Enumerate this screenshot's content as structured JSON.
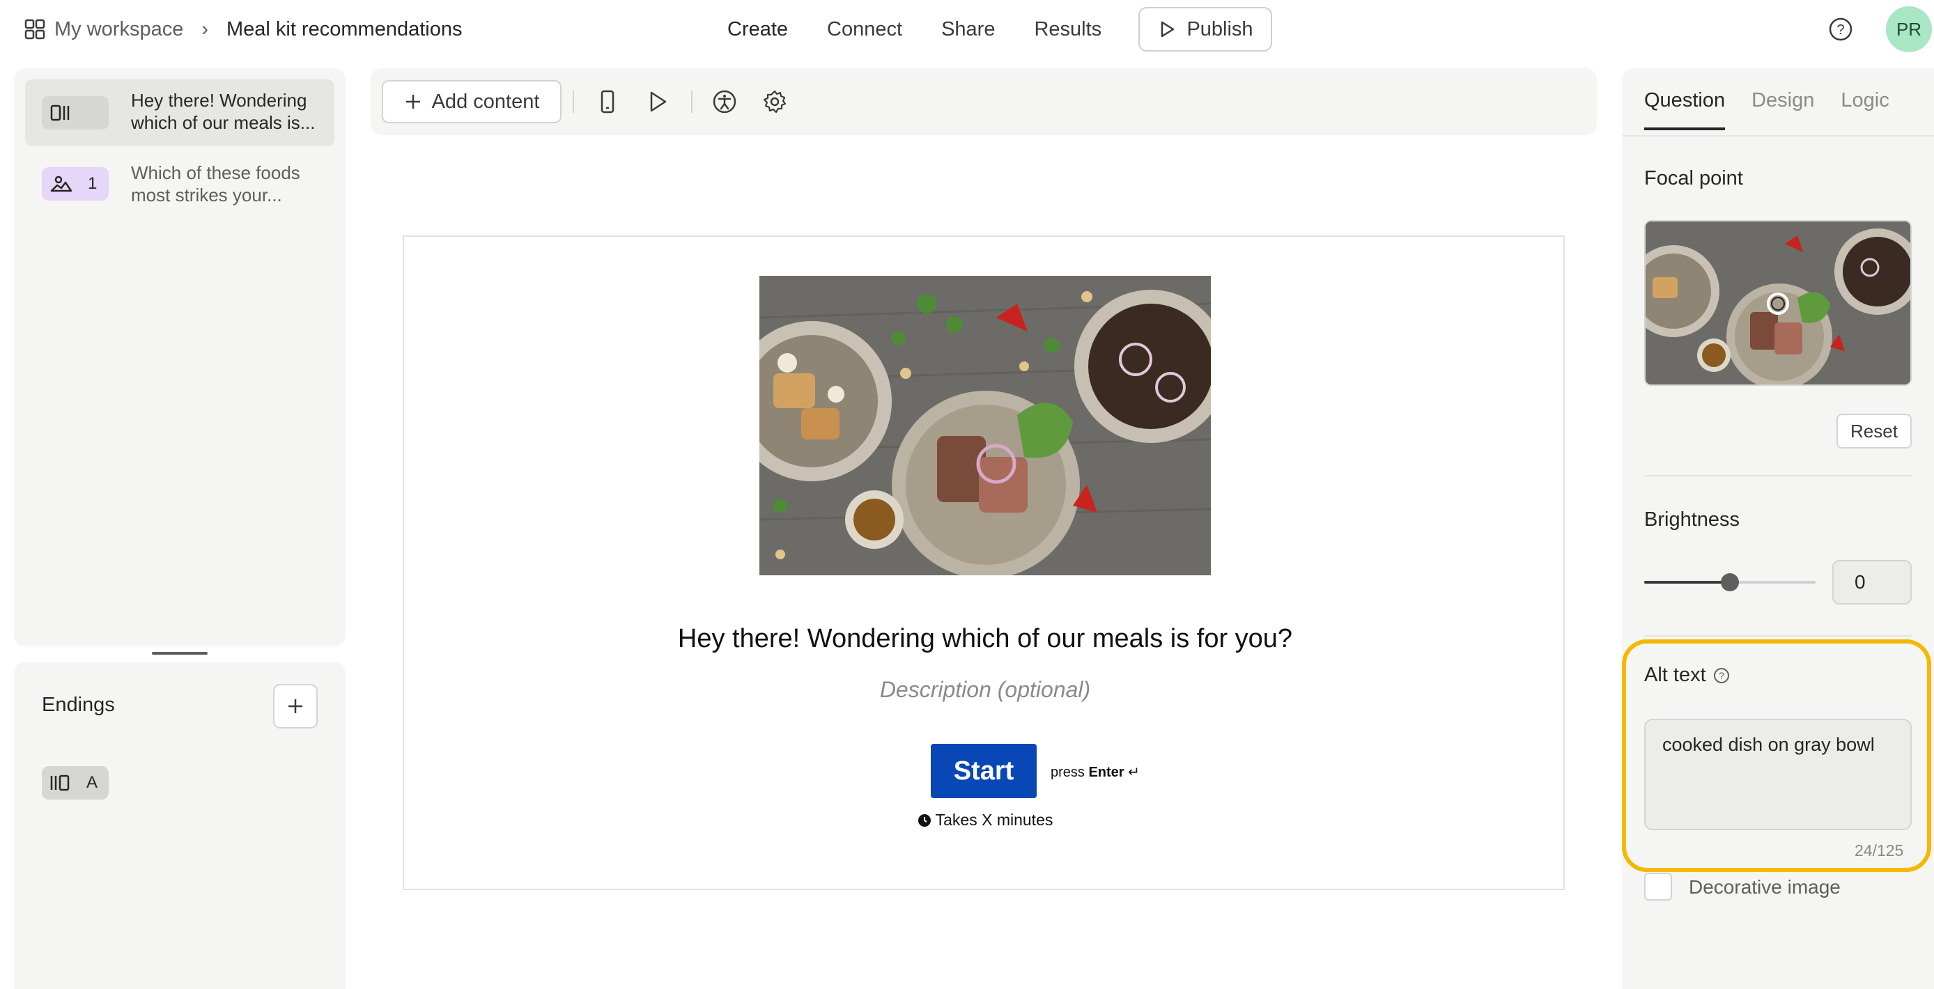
{
  "header": {
    "workspace": "My workspace",
    "form_name": "Meal kit recommendations",
    "nav": [
      "Create",
      "Connect",
      "Share",
      "Results"
    ],
    "publish_label": "Publish",
    "avatar_initials": "PR"
  },
  "questions": [
    {
      "text": "Hey there! Wondering which of our meals is...",
      "badge_number": ""
    },
    {
      "text": "Which of these foods most strikes your...",
      "badge_number": "1"
    }
  ],
  "endings": {
    "title": "Endings",
    "items": [
      {
        "letter": "A"
      }
    ]
  },
  "toolbar": {
    "add_content_label": "Add content"
  },
  "welcome": {
    "title": "Hey there! Wondering which of our meals is for you?",
    "description_placeholder": "Description (optional)",
    "start_label": "Start",
    "press_prefix": "press",
    "press_key": "Enter",
    "press_symbol": "↵",
    "takes": "Takes X minutes"
  },
  "right_panel": {
    "tabs": [
      "Question",
      "Design",
      "Logic"
    ],
    "focal_point_label": "Focal point",
    "reset_label": "Reset",
    "brightness_label": "Brightness",
    "brightness_value": "0",
    "brightness_fraction": 0.5,
    "alt_text_label": "Alt text",
    "alt_text_value": "cooked dish on gray bowl",
    "alt_text_count": "24/125",
    "decorative_label": "Decorative image"
  },
  "colors": {
    "accent_highlight": "#f5b800",
    "start_button": "#0a47b6",
    "avatar_bg": "#a8e6c4",
    "badge_purple": "#e6d6f7"
  }
}
